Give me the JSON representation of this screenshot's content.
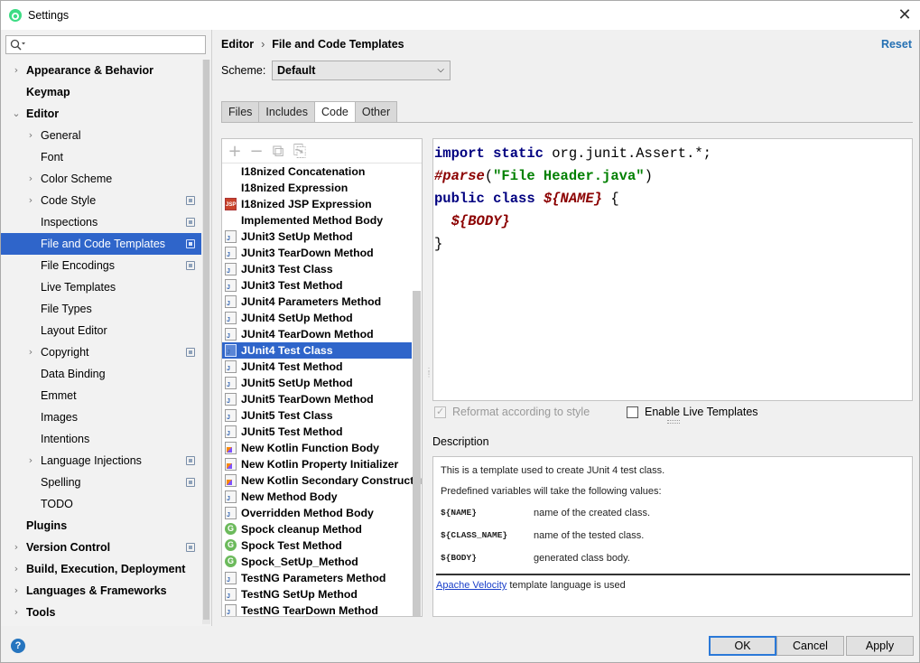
{
  "window": {
    "title": "Settings",
    "app_icon": "android-studio-icon",
    "close_icon": "close-icon"
  },
  "search": {
    "placeholder": "",
    "icon": "search-icon"
  },
  "tree": [
    {
      "label": "Appearance & Behavior",
      "level": 0,
      "arrow": true,
      "bold": true
    },
    {
      "label": "Keymap",
      "level": 0,
      "arrow": false,
      "bold": true
    },
    {
      "label": "Editor",
      "level": 0,
      "arrow": true,
      "expanded": true,
      "bold": true
    },
    {
      "label": "General",
      "level": 1,
      "arrow": true
    },
    {
      "label": "Font",
      "level": 1
    },
    {
      "label": "Color Scheme",
      "level": 1,
      "arrow": true
    },
    {
      "label": "Code Style",
      "level": 1,
      "arrow": true,
      "project": true
    },
    {
      "label": "Inspections",
      "level": 1,
      "project": true
    },
    {
      "label": "File and Code Templates",
      "level": 1,
      "project": true,
      "selected": true
    },
    {
      "label": "File Encodings",
      "level": 1,
      "project": true
    },
    {
      "label": "Live Templates",
      "level": 1
    },
    {
      "label": "File Types",
      "level": 1
    },
    {
      "label": "Layout Editor",
      "level": 1
    },
    {
      "label": "Copyright",
      "level": 1,
      "arrow": true,
      "project": true
    },
    {
      "label": "Data Binding",
      "level": 1
    },
    {
      "label": "Emmet",
      "level": 1
    },
    {
      "label": "Images",
      "level": 1
    },
    {
      "label": "Intentions",
      "level": 1
    },
    {
      "label": "Language Injections",
      "level": 1,
      "arrow": true,
      "project": true
    },
    {
      "label": "Spelling",
      "level": 1,
      "project": true
    },
    {
      "label": "TODO",
      "level": 1
    },
    {
      "label": "Plugins",
      "level": 0,
      "bold": true
    },
    {
      "label": "Version Control",
      "level": 0,
      "arrow": true,
      "bold": true,
      "project": true
    },
    {
      "label": "Build, Execution, Deployment",
      "level": 0,
      "arrow": true,
      "bold": true
    },
    {
      "label": "Languages & Frameworks",
      "level": 0,
      "arrow": true,
      "bold": true
    },
    {
      "label": "Tools",
      "level": 0,
      "arrow": true,
      "bold": true
    }
  ],
  "breadcrumb": {
    "parent": "Editor",
    "separator": "›",
    "current": "File and Code Templates"
  },
  "reset_label": "Reset",
  "scheme": {
    "label": "Scheme:",
    "value": "Default"
  },
  "tabs": [
    {
      "label": "Files"
    },
    {
      "label": "Includes"
    },
    {
      "label": "Code",
      "active": true
    },
    {
      "label": "Other"
    }
  ],
  "list_toolbar": [
    {
      "name": "add-icon",
      "glyph": "+"
    },
    {
      "name": "remove-icon",
      "glyph": "−"
    },
    {
      "name": "copy-icon",
      "glyph": "⧉"
    },
    {
      "name": "reset-template-icon",
      "glyph": "⎘"
    }
  ],
  "templates": [
    {
      "label": "I18nized Concatenation",
      "icon": "none"
    },
    {
      "label": "I18nized Expression",
      "icon": "none"
    },
    {
      "label": "I18nized JSP Expression",
      "icon": "jsp"
    },
    {
      "label": "Implemented Method Body",
      "icon": "none"
    },
    {
      "label": "JUnit3 SetUp Method",
      "icon": "java"
    },
    {
      "label": "JUnit3 TearDown Method",
      "icon": "java"
    },
    {
      "label": "JUnit3 Test Class",
      "icon": "java"
    },
    {
      "label": "JUnit3 Test Method",
      "icon": "java"
    },
    {
      "label": "JUnit4 Parameters Method",
      "icon": "java"
    },
    {
      "label": "JUnit4 SetUp Method",
      "icon": "java"
    },
    {
      "label": "JUnit4 TearDown Method",
      "icon": "java"
    },
    {
      "label": "JUnit4 Test Class",
      "icon": "java",
      "selected": true
    },
    {
      "label": "JUnit4 Test Method",
      "icon": "java"
    },
    {
      "label": "JUnit5 SetUp Method",
      "icon": "java"
    },
    {
      "label": "JUnit5 TearDown Method",
      "icon": "java"
    },
    {
      "label": "JUnit5 Test Class",
      "icon": "java"
    },
    {
      "label": "JUnit5 Test Method",
      "icon": "java"
    },
    {
      "label": "New Kotlin Function Body",
      "icon": "kotlin"
    },
    {
      "label": "New Kotlin Property Initializer",
      "icon": "kotlin"
    },
    {
      "label": "New Kotlin Secondary Constructor Body",
      "icon": "kotlin"
    },
    {
      "label": "New Method Body",
      "icon": "java"
    },
    {
      "label": "Overridden Method Body",
      "icon": "java"
    },
    {
      "label": "Spock cleanup Method",
      "icon": "groovy"
    },
    {
      "label": "Spock Test Method",
      "icon": "groovy"
    },
    {
      "label": "Spock_SetUp_Method",
      "icon": "groovy"
    },
    {
      "label": "TestNG Parameters Method",
      "icon": "java"
    },
    {
      "label": "TestNG SetUp Method",
      "icon": "java"
    },
    {
      "label": "TestNG TearDown Method",
      "icon": "java"
    }
  ],
  "code": {
    "line1_kw1": "import",
    "line1_kw2": "static",
    "line1_rest": " org.junit.Assert.*;",
    "line2_dir": "#parse",
    "line2_open": "(",
    "line2_str": "\"File Header.java\"",
    "line2_close": ")",
    "line3_kw1": "public",
    "line3_kw2": "class",
    "line3_var": "${NAME}",
    "line3_brace": " {",
    "line4_var": "${BODY}",
    "line5": "}"
  },
  "options": {
    "reformat_label": "Reformat according to style",
    "reformat_checked": true,
    "reformat_enabled": false,
    "live_templates_label": "Enable Live Templates",
    "live_templates_checked": false
  },
  "description": {
    "label": "Description",
    "intro": "This is a template used to create JUnit 4 test class.",
    "predefined": "Predefined variables will take the following values:",
    "vars": [
      {
        "name": "${NAME}",
        "desc": "name of the created class."
      },
      {
        "name": "${CLASS_NAME}",
        "desc": "name of the tested class."
      },
      {
        "name": "${BODY}",
        "desc": "generated class body."
      }
    ],
    "link_text": "Apache Velocity",
    "link_suffix": " template language is used"
  },
  "footer": {
    "help_icon": "help-icon",
    "ok": "OK",
    "cancel": "Cancel",
    "apply": "Apply"
  },
  "colors": {
    "selection": "#2f65ca",
    "link": "#2470b3",
    "keyword": "#000080",
    "directive": "#8b0000",
    "string": "#008000"
  }
}
